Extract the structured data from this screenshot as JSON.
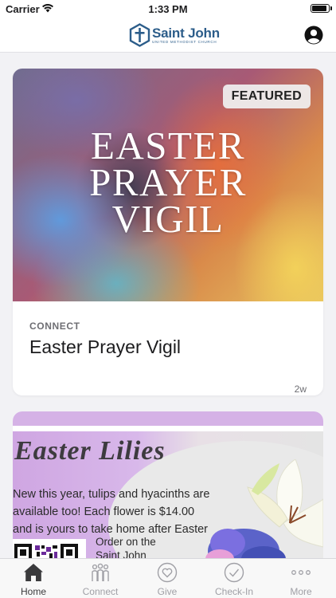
{
  "status_bar": {
    "carrier": "Carrier",
    "time": "1:33 PM"
  },
  "nav": {
    "logo_title": "Saint John",
    "logo_subtitle": "UNITED METHODIST CHURCH"
  },
  "featured_card": {
    "badge": "FEATURED",
    "hero_lines": [
      "EASTER",
      "PRAYER",
      "VIGIL"
    ],
    "category": "CONNECT",
    "title": "Easter Prayer Vigil",
    "age": "2w"
  },
  "lilies_card": {
    "heading": "Easter Lilies",
    "body_lines": [
      "New this year, tulips and hyacinths are",
      "available too! Each flower is $14.00",
      "and is yours to take home after Easter"
    ],
    "order_lines": [
      "Order on the",
      "Saint John"
    ]
  },
  "tab_bar": {
    "tabs": [
      {
        "label": "Home",
        "icon": "home-icon",
        "active": true
      },
      {
        "label": "Connect",
        "icon": "people-icon",
        "active": false
      },
      {
        "label": "Give",
        "icon": "heart-icon",
        "active": false
      },
      {
        "label": "Check-In",
        "icon": "checkmark-icon",
        "active": false
      },
      {
        "label": "More",
        "icon": "ellipsis-icon",
        "active": false
      }
    ]
  },
  "colors": {
    "brand": "#2c5d8a",
    "lilies_band": "#d5b2e6",
    "tab_active": "#3a3a3c",
    "tab_inactive": "#a0a0a6"
  }
}
